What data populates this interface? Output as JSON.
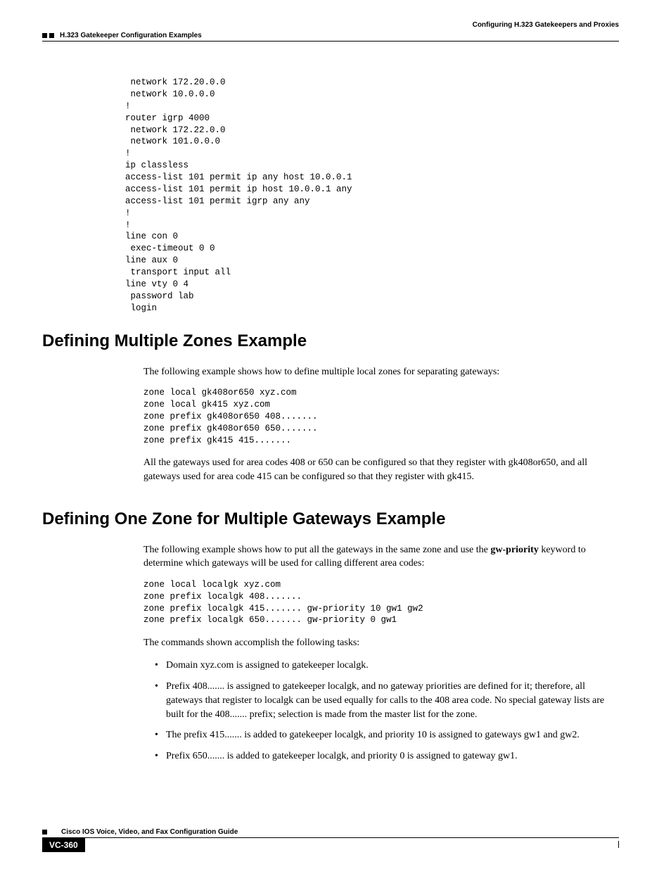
{
  "header": {
    "chapter_title": "Configuring H.323 Gatekeepers and Proxies",
    "section_title": "H.323 Gatekeeper Configuration Examples"
  },
  "code_block_1": " network 172.20.0.0\n network 10.0.0.0\n!\nrouter igrp 4000\n network 172.22.0.0\n network 101.0.0.0\n!\nip classless\naccess-list 101 permit ip any host 10.0.0.1\naccess-list 101 permit ip host 10.0.0.1 any\naccess-list 101 permit igrp any any\n!\n!\nline con 0\n exec-timeout 0 0\nline aux 0\n transport input all\nline vty 0 4\n password lab\n login",
  "section1": {
    "heading": "Defining Multiple Zones Example",
    "para1": "The following example shows how to define multiple local zones for separating gateways:",
    "code": "zone local gk408or650 xyz.com\nzone local gk415 xyz.com\nzone prefix gk408or650 408.......\nzone prefix gk408or650 650.......\nzone prefix gk415 415.......",
    "para2": "All the gateways used for area codes 408 or 650 can be configured so that they register with gk408or650, and all gateways used for area code 415 can be configured so that they register with gk415."
  },
  "section2": {
    "heading": "Defining One Zone for Multiple Gateways Example",
    "para1_pre": "The following example shows how to put all the gateways in the same zone and use the ",
    "para1_bold": "gw-priority",
    "para1_post": " keyword to determine which gateways will be used for calling different area codes:",
    "code": "zone local localgk xyz.com\nzone prefix localgk 408.......\nzone prefix localgk 415....... gw-priority 10 gw1 gw2\nzone prefix localgk 650....... gw-priority 0 gw1",
    "para2": "The commands shown accomplish the following tasks:",
    "bullets": [
      "Domain xyz.com is assigned to gatekeeper localgk.",
      "Prefix 408....... is assigned to gatekeeper localgk, and no gateway priorities are defined for it; therefore, all gateways that register to localgk can be used equally for calls to the 408 area code. No special gateway lists are built for the 408....... prefix; selection is made from the master list for the zone.",
      "The prefix 415....... is added to gatekeeper localgk, and priority 10 is assigned to gateways gw1 and gw2.",
      "Prefix 650....... is added to gatekeeper localgk, and priority 0 is assigned to gateway gw1."
    ]
  },
  "footer": {
    "book_title": "Cisco IOS Voice, Video, and Fax Configuration Guide",
    "page_number": "VC-360"
  }
}
